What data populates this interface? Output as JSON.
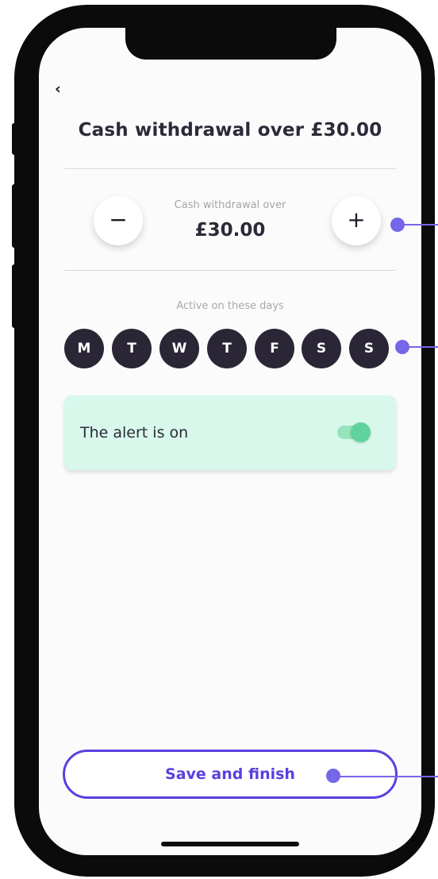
{
  "nav": {
    "back_glyph": "‹"
  },
  "header": {
    "title": "Cash withdrawal over £30.00"
  },
  "amount": {
    "label": "Cash withdrawal over",
    "value": "£30.00",
    "decrease_glyph": "−",
    "increase_glyph": "+"
  },
  "days": {
    "label": "Active on these days",
    "items": [
      "M",
      "T",
      "W",
      "T",
      "F",
      "S",
      "S"
    ]
  },
  "alert": {
    "text": "The alert is on",
    "enabled": true
  },
  "footer": {
    "save_label": "Save and finish"
  },
  "colors": {
    "accent": "#5b3fe0",
    "callout": "#7666e8",
    "day_chip": "#2a2636",
    "alert_bg": "#d8f8ec",
    "toggle_on": "#5fd39b"
  },
  "icons": {
    "back": "chevron-left-icon",
    "minus": "minus-icon",
    "plus": "plus-icon"
  }
}
